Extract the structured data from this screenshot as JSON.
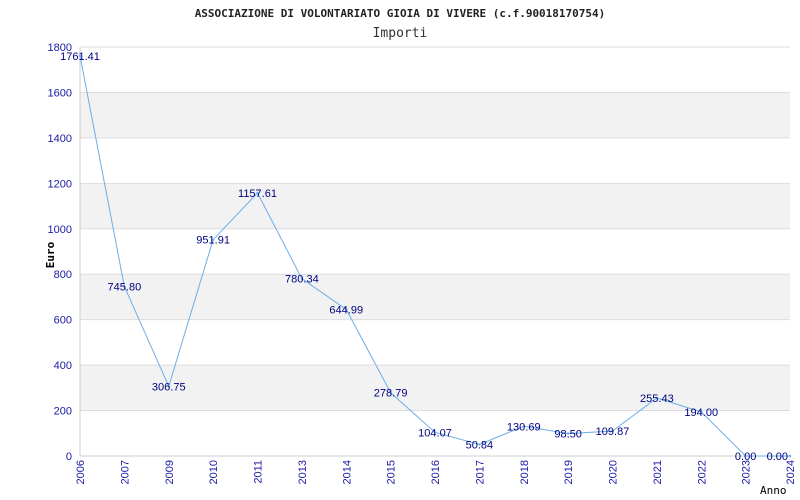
{
  "chart_data": {
    "type": "line",
    "title": "ASSOCIAZIONE DI VOLONTARIATO GIOIA DI VIVERE (c.f.90018170754)",
    "subtitle": "Importi",
    "ylabel": "Euro",
    "xlabel": "Anno",
    "ylim": [
      0,
      1800
    ],
    "yticks": [
      0,
      200,
      400,
      600,
      800,
      1000,
      1200,
      1400,
      1600,
      1800
    ],
    "grid": true,
    "categories": [
      "2006",
      "2007",
      "2009",
      "2010",
      "2011",
      "2013",
      "2014",
      "2015",
      "2016",
      "2017",
      "2018",
      "2019",
      "2020",
      "2021",
      "2022",
      "2023",
      "2024"
    ],
    "values": [
      1761.41,
      745.8,
      306.75,
      951.91,
      1157.61,
      780.34,
      644.99,
      278.79,
      104.07,
      50.84,
      130.69,
      98.5,
      109.87,
      255.43,
      194.0,
      0.0,
      0.0
    ],
    "value_labels": [
      "1761.41",
      "745.80",
      "306.75",
      "951.91",
      "1157.61",
      "780.34",
      "644.99",
      "278.79",
      "104.07",
      "50.84",
      "130.69",
      "98.50",
      "109.87",
      "255.43",
      "194.00",
      "0.00",
      "0.00"
    ],
    "series_color": "#6aaee8",
    "band_color": "#f2f2f2",
    "grid_color": "#dddddd"
  }
}
